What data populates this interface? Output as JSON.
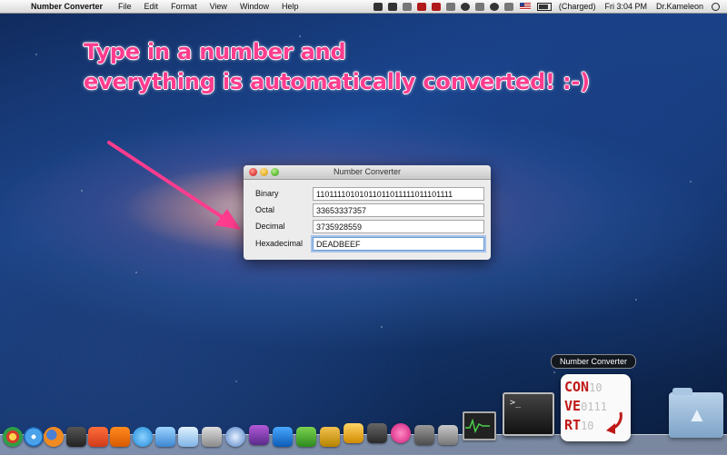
{
  "menubar": {
    "app_name": "Number Converter",
    "items": [
      "File",
      "Edit",
      "Format",
      "View",
      "Window",
      "Help"
    ],
    "battery_status": "(Charged)",
    "clock": "Fri 3:04 PM",
    "user": "Dr.Kameleon"
  },
  "headline": {
    "line1": "Type in a number and",
    "line2": "everything is automatically converted! :-)"
  },
  "window": {
    "title": "Number Converter",
    "fields": {
      "binary": {
        "label": "Binary",
        "value": "11011110101011011011111011101111"
      },
      "octal": {
        "label": "Octal",
        "value": "33653337357"
      },
      "decimal": {
        "label": "Decimal",
        "value": "3735928559"
      },
      "hexadecimal": {
        "label": "Hexadecimal",
        "value": "DEADBEEF"
      }
    }
  },
  "dock": {
    "tooltip": "Number Converter",
    "terminal_prompt": ">_",
    "app_icon_text": {
      "line1": "CON",
      "line1_bits": "10",
      "line2": "VE",
      "line2_bits": "0111",
      "line3": "RT",
      "line3_bits": "10"
    },
    "colors": {
      "accent_pink": "#ff3c8e",
      "app_icon_red": "#c01818"
    }
  }
}
